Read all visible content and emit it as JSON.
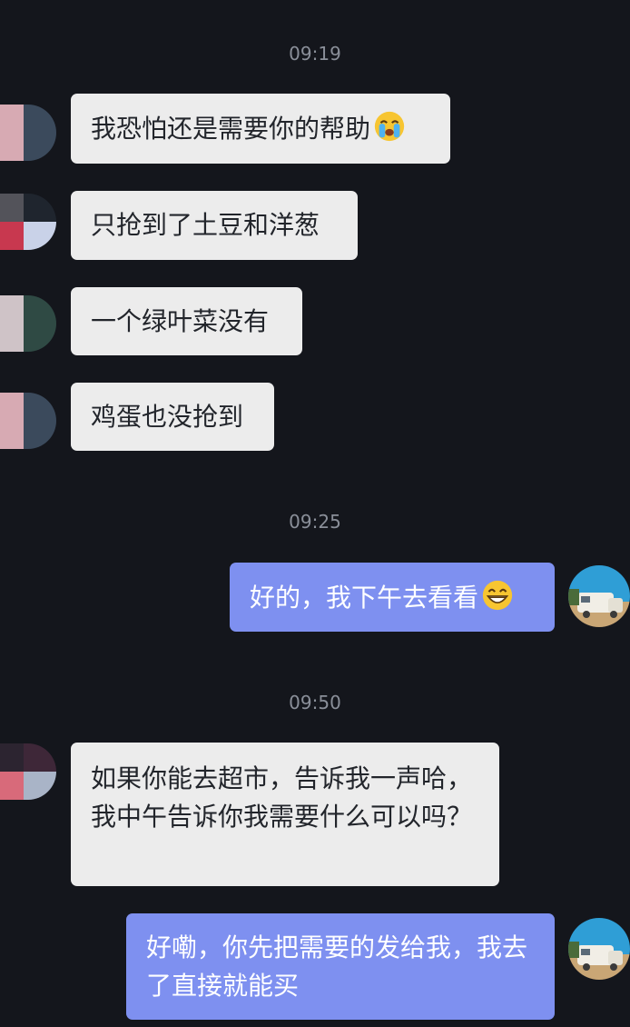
{
  "conversation": {
    "timestamps": [
      "09:19",
      "09:25",
      "09:50"
    ],
    "messages": [
      {
        "from": "them",
        "text": "我恐怕还是需要你的帮助",
        "emoji": "crying-face-icon"
      },
      {
        "from": "them",
        "text": "只抢到了土豆和洋葱"
      },
      {
        "from": "them",
        "text": "一个绿叶菜没有"
      },
      {
        "from": "them",
        "text": "鸡蛋也没抢到"
      },
      {
        "from": "me",
        "text": "好的，我下午去看看",
        "emoji": "grinning-face-icon"
      },
      {
        "from": "them",
        "text": "如果你能去超市，告诉我一声哈，我中午告诉你我需要什么可以吗？"
      },
      {
        "from": "me",
        "text": "好嘞，你先把需要的发给我，我去了直接就能买"
      }
    ]
  },
  "colors": {
    "background": "#14161c",
    "incoming_bubble": "#ececec",
    "outgoing_bubble": "#7e90f0",
    "timestamp_text": "#8a8f99"
  }
}
